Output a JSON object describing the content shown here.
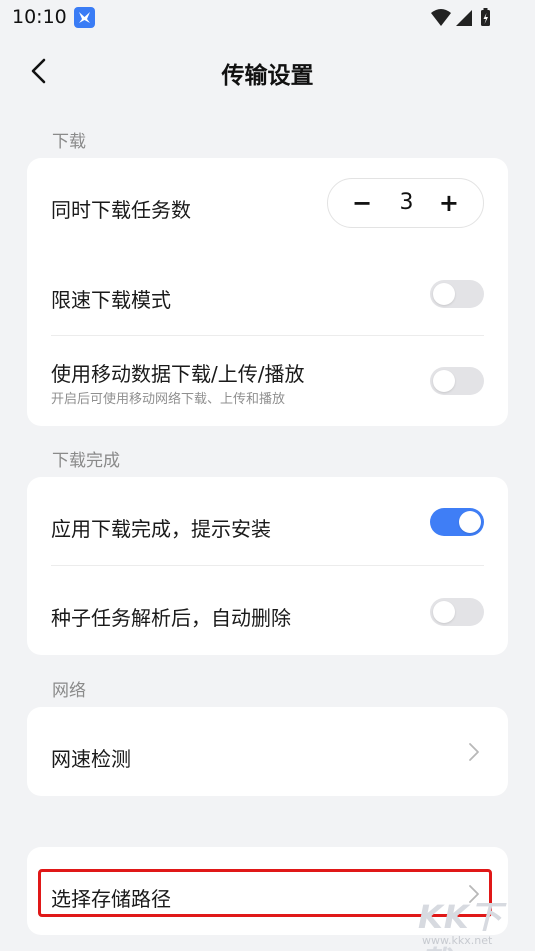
{
  "status_bar": {
    "time": "10:10"
  },
  "header": {
    "title": "传输设置"
  },
  "sections": {
    "download": {
      "label": "下载",
      "concurrent": {
        "label": "同时下载任务数",
        "minus": "−",
        "value": "3",
        "plus": "+"
      },
      "speed_limit": {
        "label": "限速下载模式",
        "enabled": false
      },
      "mobile_data": {
        "label": "使用移动数据下载/上传/播放",
        "sub": "开启后可使用移动网络下载、上传和播放",
        "enabled": false
      }
    },
    "download_complete": {
      "label": "下载完成",
      "prompt_install": {
        "label": "应用下载完成，提示安装",
        "enabled": true
      },
      "auto_delete_torrent": {
        "label": "种子任务解析后，自动删除",
        "enabled": false
      }
    },
    "network": {
      "label": "网络",
      "speed_test": {
        "label": "网速检测"
      }
    },
    "storage": {
      "path": {
        "label": "选择存储路径"
      }
    }
  },
  "watermark": {
    "logo": "KK下载",
    "url": "www.kkx.net"
  },
  "colors": {
    "accent": "#3f7ef6",
    "highlight": "#e01818",
    "background": "#f2f3f5"
  }
}
